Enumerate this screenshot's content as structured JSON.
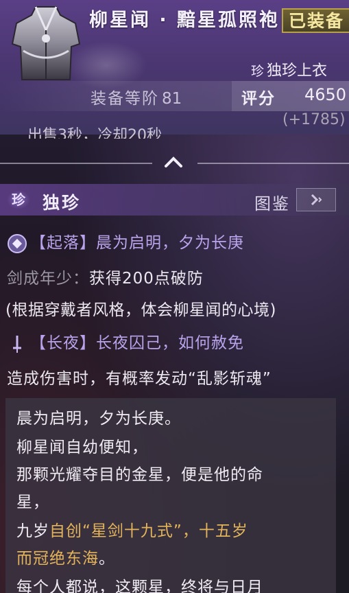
{
  "item": {
    "title": "柳星闻 · 黯星孤照袍",
    "equipped_label": "已装备",
    "rarity_badge": "珍",
    "slot": "独珍上衣",
    "tier_label": "装备等阶",
    "tier_value": "81",
    "score_label": "评分",
    "score_value": "4650",
    "score_delta": "(+1785)",
    "cut_text": "出售3秒，冷却20秒"
  },
  "rarity": {
    "badge": "珍",
    "label": "独珍",
    "atlas_label": "图鉴"
  },
  "skills": [
    {
      "icon": "diamond-emblem-icon",
      "bracket_open": "【",
      "name": "起落",
      "bracket_close": "】",
      "phrase": "晨为启明，夕为长庚",
      "effect_source": "剑成年少：",
      "effect": "获得200点破防",
      "note": "(根据穿戴者风格，体会柳星闻的心境)"
    },
    {
      "icon": "sword-icon",
      "bracket_open": "【",
      "name": "长夜",
      "bracket_close": "】",
      "phrase": "长夜囚己，如何赦免",
      "effect": "造成伤害时，有概率发动“乱影斩魂”"
    }
  ],
  "lore": {
    "line1": "晨为启明，夕为长庚。",
    "line2": "柳星闻自幼便知，",
    "line3": "那颗光耀夺目的金星，便是他的命",
    "line4": "星，",
    "line5_a": "九岁",
    "line5_b": "自创“星剑十九式”，十五岁",
    "line6_a": "而冠绝东海",
    "line6_b": "。",
    "line7": "每个人都说，这颗星，终将与日月"
  },
  "colors": {
    "accent_purple": "#b9a4ec",
    "gold": "#e4b45a",
    "badge_gold": "#b7a24a"
  }
}
